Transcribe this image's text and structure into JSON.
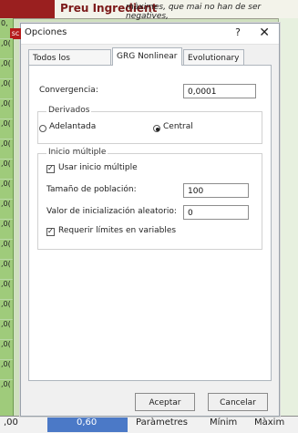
{
  "background": {
    "top_title": "Preu Ingredient",
    "top_note": "màximes, que mai no han de ser negatives,",
    "left_values": [
      "0,",
      ",0(",
      ",0(",
      ",0(",
      ",0(",
      ",0(",
      ",0(",
      ",0(",
      ",0(",
      ",0(",
      ",0(",
      ",0(",
      ",0(",
      ",0(",
      ",0(",
      ",0(",
      ",0(",
      ",0(",
      ",0("
    ],
    "bottom_cells": {
      "left": ",00",
      "blue": "0,60",
      "center": "Paràmetres",
      "min": "Mínim",
      "max": "Màxim"
    }
  },
  "dialog": {
    "title": "Opciones",
    "help": "?",
    "close": "✕",
    "tabs": [
      "Todos los métodos",
      "GRG Nonlinear",
      "Evolutionary"
    ],
    "active_tab": 1,
    "convergence_label": "Convergencia:",
    "convergence_value": "0,0001",
    "derivatives": {
      "title": "Derivados",
      "forward": "Adelantada",
      "central": "Central",
      "selected": "Central"
    },
    "multistart": {
      "title": "Inicio múltiple",
      "use_multistart": "Usar inicio múltiple",
      "population_label": "Tamaño de población:",
      "population_value": "100",
      "seed_label": "Valor de inicialización aleatorio:",
      "seed_value": "0",
      "require_bounds": "Requerir límites en variables"
    },
    "buttons": {
      "accept": "Aceptar",
      "cancel": "Cancelar"
    }
  }
}
